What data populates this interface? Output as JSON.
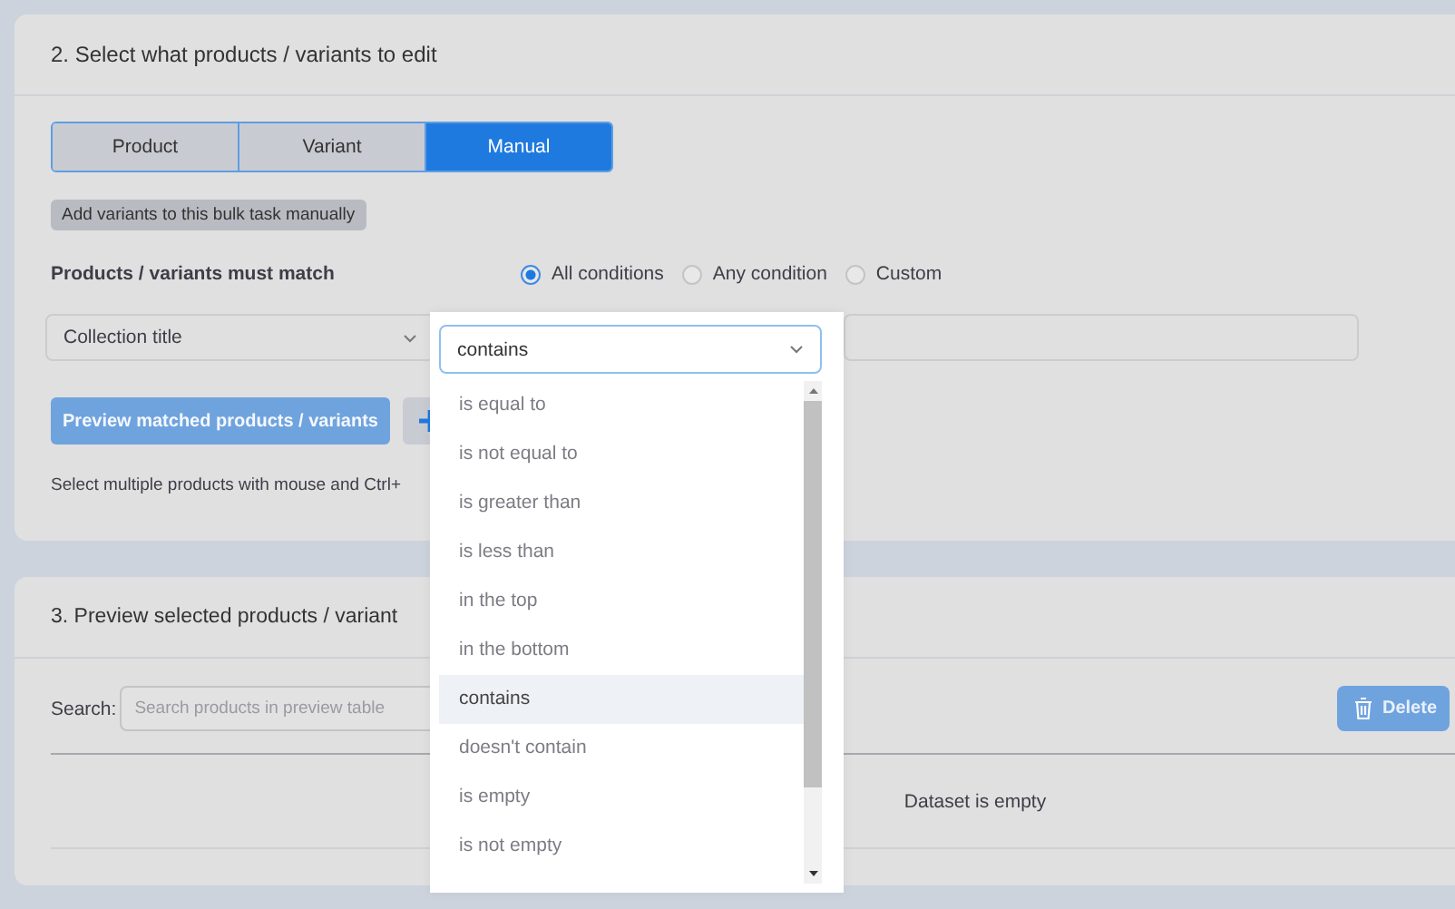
{
  "select_section": {
    "title": "2. Select what products / variants to edit",
    "tabs": [
      {
        "label": "Product",
        "selected": false
      },
      {
        "label": "Variant",
        "selected": false
      },
      {
        "label": "Manual",
        "selected": true
      }
    ],
    "hint_badge": "Add variants to this bulk task manually",
    "match": {
      "label": "Products / variants must match",
      "options": [
        {
          "label": "All conditions",
          "selected": true
        },
        {
          "label": "Any condition",
          "selected": false
        },
        {
          "label": "Custom",
          "selected": false
        }
      ]
    },
    "condition": {
      "field": "Collection title"
    },
    "preview_button": "Preview matched products / variants",
    "help_text": "Select multiple products with mouse and Ctrl+"
  },
  "preview_section": {
    "title": "3. Preview selected products / variant",
    "search": {
      "label": "Search:",
      "placeholder": "Search products in preview table"
    },
    "delete_button": "Delete",
    "empty_message": "Dataset is empty"
  },
  "operator_dropdown": {
    "value": "contains",
    "options": [
      {
        "label": "is equal to",
        "selected": false
      },
      {
        "label": "is not equal to",
        "selected": false
      },
      {
        "label": "is greater than",
        "selected": false
      },
      {
        "label": "is less than",
        "selected": false
      },
      {
        "label": "in the top",
        "selected": false
      },
      {
        "label": "in the bottom",
        "selected": false
      },
      {
        "label": "contains",
        "selected": true
      },
      {
        "label": "doesn't contain",
        "selected": false
      },
      {
        "label": "is empty",
        "selected": false
      },
      {
        "label": "is not empty",
        "selected": false
      }
    ]
  }
}
